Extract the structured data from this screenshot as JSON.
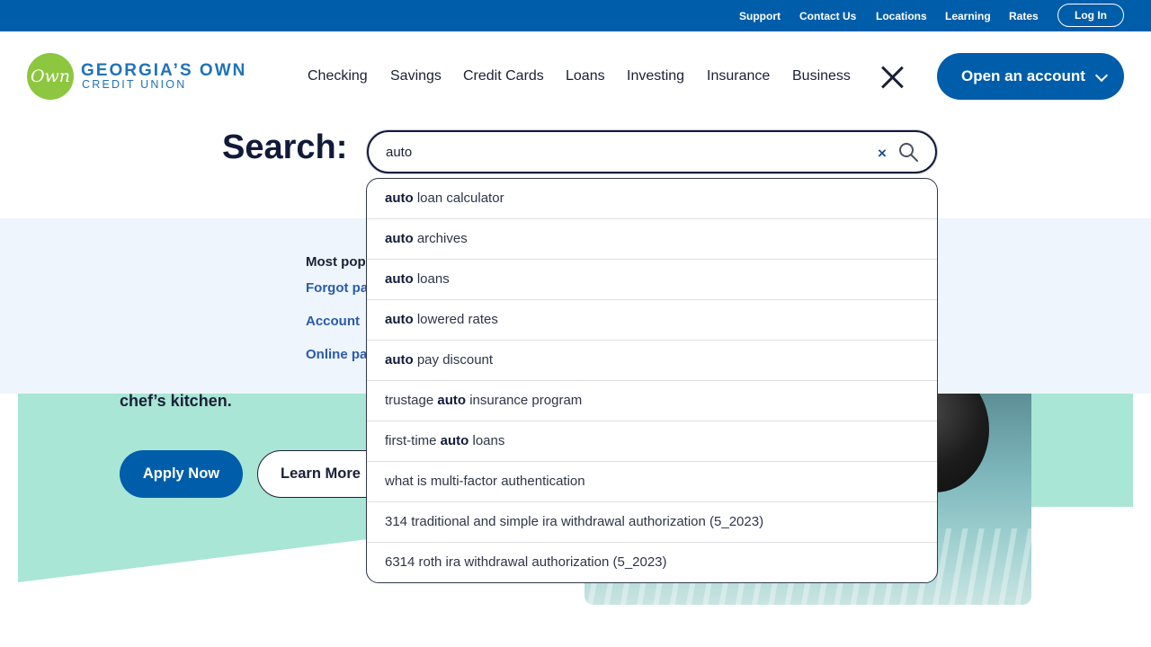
{
  "topbar": {
    "links": [
      "Support",
      "Contact Us",
      "Locations",
      "Learning",
      "Rates"
    ],
    "login_label": "Log In"
  },
  "brand": {
    "mark": "Own",
    "name": "GEORGIA’S OWN",
    "sub": "CREDIT UNION",
    "color": "#005da9",
    "accent": "#8dc63f"
  },
  "nav": {
    "items": [
      "Checking",
      "Savings",
      "Credit Cards",
      "Loans",
      "Investing",
      "Insurance",
      "Business"
    ],
    "close_icon": "close-icon",
    "cta_label": "Open an account"
  },
  "search": {
    "label": "Search:",
    "value": "auto",
    "clear_icon": "clear-icon",
    "submit_icon": "search-icon"
  },
  "suggestions": [
    {
      "pre": "",
      "match": "auto",
      "post": " loan calculator"
    },
    {
      "pre": "",
      "match": "auto",
      "post": " archives"
    },
    {
      "pre": "",
      "match": "auto",
      "post": " loans"
    },
    {
      "pre": "",
      "match": "auto",
      "post": " lowered rates"
    },
    {
      "pre": "",
      "match": "auto",
      "post": " pay discount"
    },
    {
      "pre": "trustage ",
      "match": "auto",
      "post": " insurance program"
    },
    {
      "pre": "first-time ",
      "match": "auto",
      "post": " loans"
    },
    {
      "pre": "what is multi-factor authentication",
      "match": "",
      "post": ""
    },
    {
      "pre": "314 traditional and simple ira withdrawal authorization (5_2023)",
      "match": "",
      "post": ""
    },
    {
      "pre": "6314 roth ira withdrawal authorization (5_2023)",
      "match": "",
      "post": ""
    }
  ],
  "popular": {
    "title": "Most pop",
    "links": [
      "Forgot pa",
      "Account",
      "Online pa"
    ]
  },
  "hero": {
    "text": "chef’s kitchen.",
    "apply_label": "Apply Now",
    "learn_label": "Learn More"
  }
}
